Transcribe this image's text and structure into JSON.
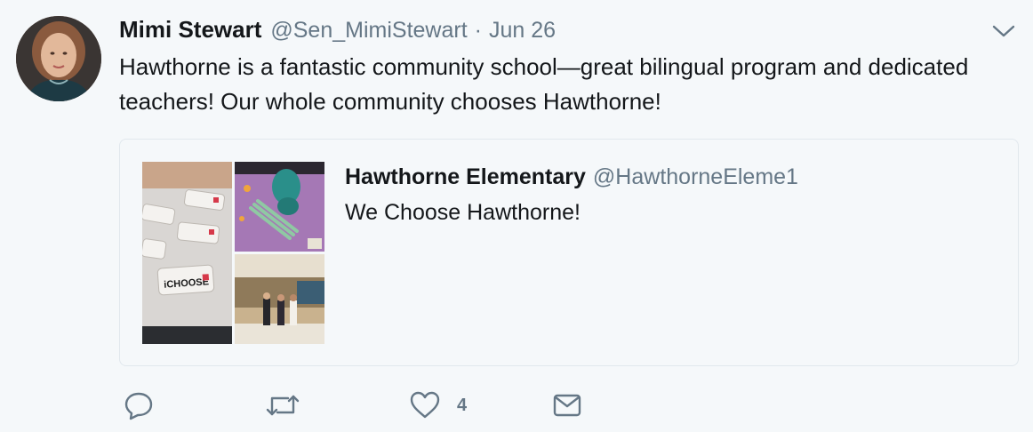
{
  "tweet": {
    "author_name": "Mimi Stewart",
    "author_handle": "@Sen_MimiStewart",
    "separator": "·",
    "date": "Jun 26",
    "text": "Hawthorne is a fantastic community school—great bilingual program and dedicated teachers! Our whole community chooses Hawthorne!"
  },
  "quoted_tweet": {
    "author_name": "Hawthorne Elementary",
    "author_handle": "@HawthorneEleme1",
    "text": "We Choose Hawthorne!",
    "sign_text": "iCHOOSE"
  },
  "actions": {
    "reply_icon": "reply-icon",
    "retweet_icon": "retweet-icon",
    "like_icon": "heart-icon",
    "like_count": "4",
    "dm_icon": "envelope-icon"
  },
  "colors": {
    "background": "#f5f8fa",
    "text": "#14171a",
    "secondary": "#657786",
    "border": "#e1e8ed"
  }
}
